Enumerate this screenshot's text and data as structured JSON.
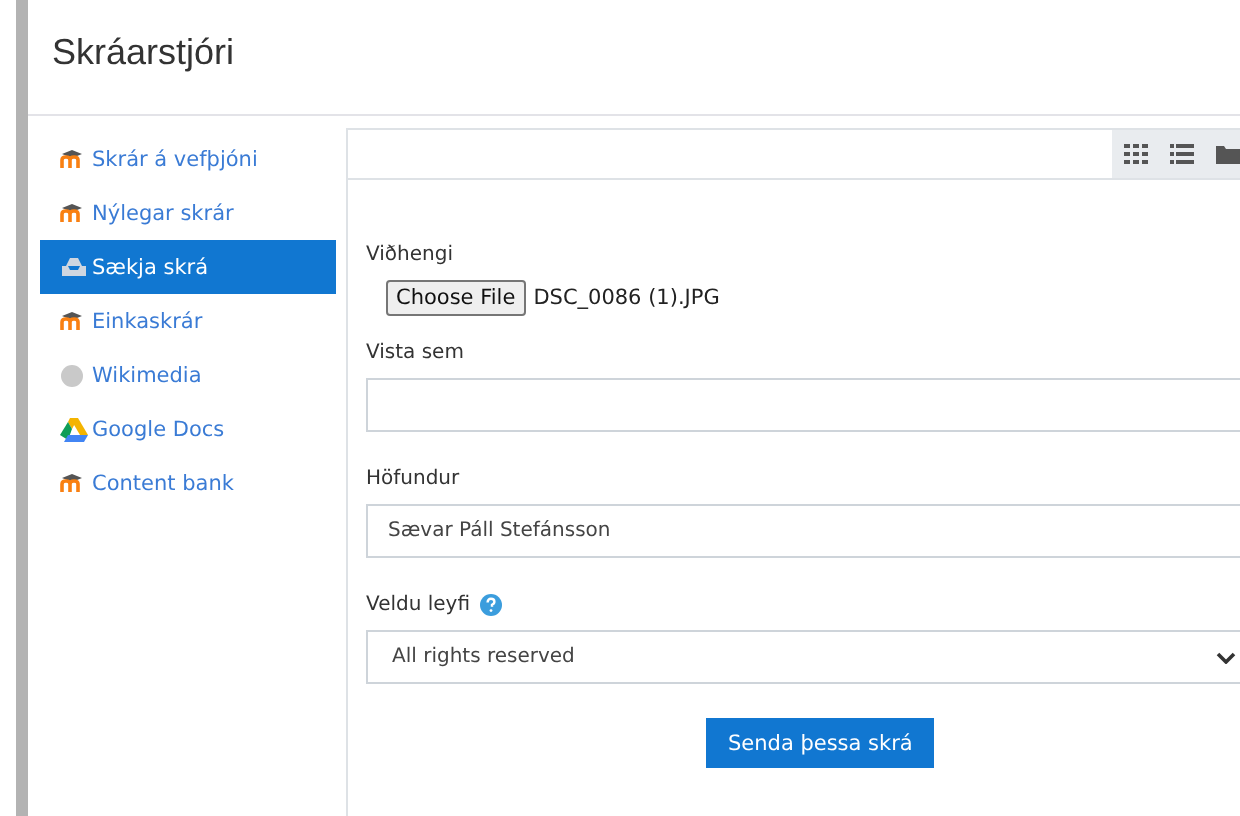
{
  "dialog": {
    "title": "Skráarstjóri"
  },
  "sidebar": {
    "items": [
      {
        "label": "Skrár á vefþjóni",
        "kind": "moodle",
        "selected": false
      },
      {
        "label": "Nýlegar skrár",
        "kind": "moodle",
        "selected": false
      },
      {
        "label": "Sækja skrá",
        "kind": "upload",
        "selected": true
      },
      {
        "label": "Einkaskrár",
        "kind": "moodle",
        "selected": false
      },
      {
        "label": "Wikimedia",
        "kind": "globe",
        "selected": false
      },
      {
        "label": "Google Docs",
        "kind": "drive",
        "selected": false
      },
      {
        "label": "Content bank",
        "kind": "moodle",
        "selected": false
      }
    ]
  },
  "form": {
    "attachment": {
      "label": "Viðhengi",
      "button": "Choose File",
      "file": "DSC_0086 (1).JPG"
    },
    "save_as": {
      "label": "Vista sem"
    },
    "author": {
      "label": "Höfundur",
      "value": "Sævar Páll Stefánsson"
    },
    "license": {
      "label": "Veldu leyfi",
      "value": "All rights reserved"
    },
    "submit": "Senda þessa skrá"
  }
}
